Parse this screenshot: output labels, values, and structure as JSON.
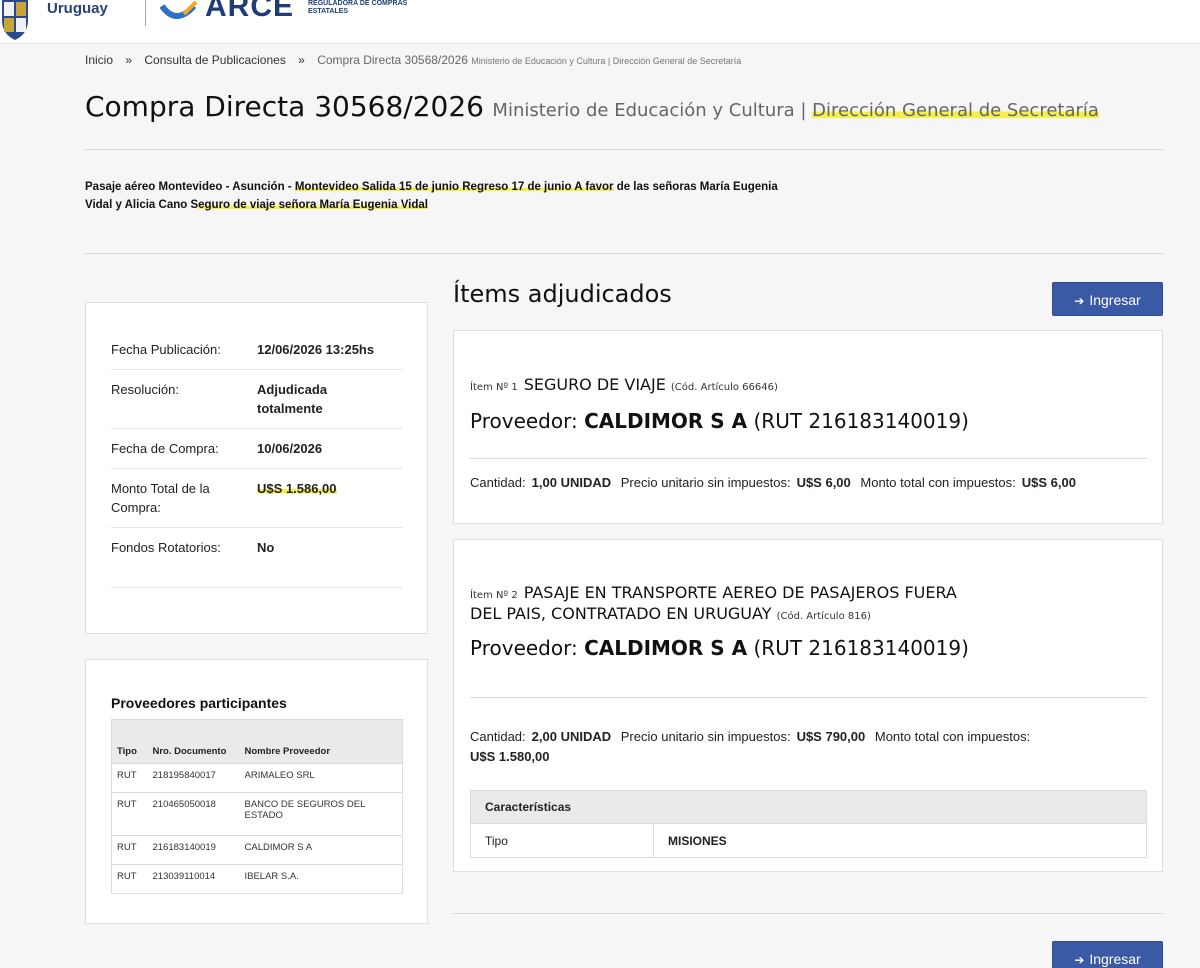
{
  "header": {
    "country": "Uruguay",
    "brand": "ARCE",
    "brand_sub": "REGULADORA DE COMPRAS ESTATALES"
  },
  "breadcrumb": {
    "home": "Inicio",
    "separator": "»",
    "consulta": "Consulta de Publicaciones",
    "current": "Compra Directa 30568/2026",
    "current_org": "Ministerio de Educación y Cultura | Dirección General de Secretaría"
  },
  "title": {
    "main": "Compra Directa 30568/2026",
    "org_a": "Ministerio de Educación y Cultura |",
    "org_b": "Dirección General de Secretaría"
  },
  "description": {
    "part1": "Pasaje aéreo Montevideo - Asunción - ",
    "part2": "Montevideo Salida 15 de junio Regreso 17 de junio A favor",
    "part3": " de las señoras María Eugenia Vidal y Alicia Cano S",
    "part4": "eguro de viaje señora María Eugenia Vidal"
  },
  "info": {
    "fecha_publicacion": {
      "label": "Fecha Publicación:",
      "value": "12/06/2026 13:25hs"
    },
    "resolucion": {
      "label": "Resolución:",
      "value": "Adjudicada totalmente"
    },
    "fecha_compra": {
      "label": "Fecha de Compra:",
      "value": "10/06/2026"
    },
    "monto_total": {
      "label": "Monto Total de la Compra:",
      "value": "U$S 1.586,00"
    },
    "fondos": {
      "label": "Fondos Rotatorios:",
      "value": "No"
    }
  },
  "proveedores": {
    "title": "Proveedores participantes",
    "headers": {
      "tipo": "Tipo",
      "doc": "Nro. Documento",
      "nombre": "Nombre Proveedor"
    },
    "rows": [
      {
        "tipo": "RUT",
        "doc": "218195840017",
        "nombre": "ARIMALEO SRL"
      },
      {
        "tipo": "RUT",
        "doc": "210465050018",
        "nombre": "BANCO DE SEGUROS DEL ESTADO"
      },
      {
        "tipo": "RUT",
        "doc": "216183140019",
        "nombre": "CALDIMOR S A"
      },
      {
        "tipo": "RUT",
        "doc": "213039110014",
        "nombre": "IBELAR S.A."
      }
    ]
  },
  "items": {
    "title": "Ítems adjudicados",
    "ingresar_label": "Ingresar",
    "list": [
      {
        "num": "Ítem Nº 1",
        "name": "SEGURO DE VIAJE",
        "cod": "(Cód. Artículo 66646)",
        "proveedor_label": "Proveedor:",
        "proveedor_name": "CALDIMOR S A",
        "proveedor_rut": "(RUT 216183140019)",
        "cantidad_label": "Cantidad:",
        "cantidad": "1,00 UNIDAD",
        "precio_label": "Precio unitario sin impuestos:",
        "precio": "U$S 6,00",
        "monto_label": "Monto total con impuestos:",
        "monto": "U$S 6,00"
      },
      {
        "num": "Ítem Nº 2",
        "name_line1": "PASAJE EN TRANSPORTE AEREO DE PASAJEROS FUERA",
        "name_line2": "DEL PAIS, CONTRATADO EN URUGUAY",
        "cod": "(Cód. Artículo 816)",
        "proveedor_label": "Proveedor:",
        "proveedor_name": "CALDIMOR S A",
        "proveedor_rut": "(RUT 216183140019)",
        "cantidad_label": "Cantidad:",
        "cantidad": "2,00 UNIDAD",
        "precio_label": "Precio unitario sin impuestos:",
        "precio": "U$S 790,00",
        "monto_label": "Monto total con impuestos:",
        "monto": "U$S 1.580,00",
        "caracteristicas_title": "Características",
        "caracteristica_key": "Tipo",
        "caracteristica_value": "MISIONES"
      }
    ]
  },
  "colors": {
    "accent": "#3b5aa6",
    "highlight": "#f4ee4f",
    "brand_navy": "#1e3d78"
  }
}
